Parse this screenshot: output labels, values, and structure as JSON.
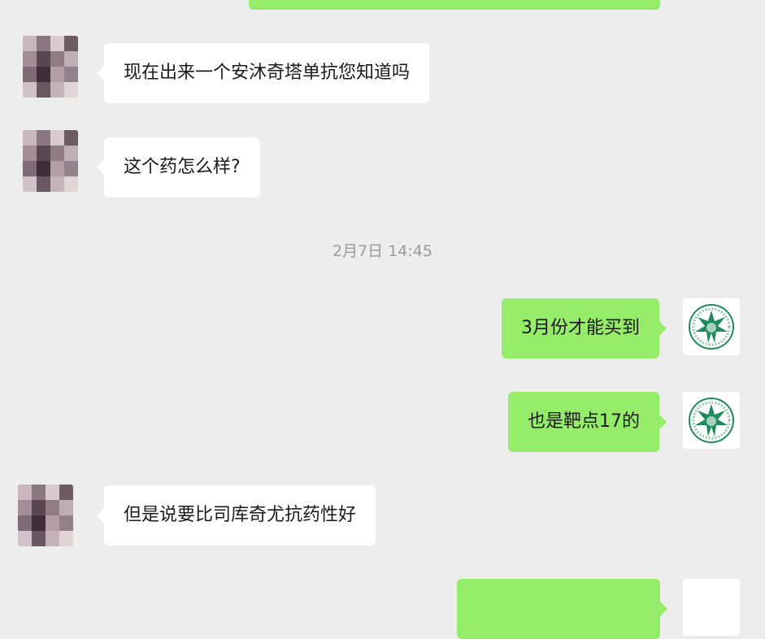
{
  "chat": {
    "messages": [
      {
        "id": "m1",
        "from": "other",
        "text": "现在出来一个安沐奇塔单抗您知道吗"
      },
      {
        "id": "m2",
        "from": "other",
        "text": "这个药怎么样?"
      },
      {
        "id": "m3",
        "from": "self",
        "text": "3月份才能买到"
      },
      {
        "id": "m4",
        "from": "self",
        "text": "也是靶点17的"
      },
      {
        "id": "m5",
        "from": "other",
        "text": "但是说要比司库奇尤抗药性好"
      }
    ],
    "timestamp": "2月7日 14:45"
  },
  "colors": {
    "background": "#ededed",
    "incoming_bubble": "#ffffff",
    "outgoing_bubble": "#95ec69",
    "timestamp_text": "#9a9a9a"
  },
  "icons": {
    "other_avatar": "pixelated-avatar",
    "self_avatar": "green-emblem-avatar"
  }
}
